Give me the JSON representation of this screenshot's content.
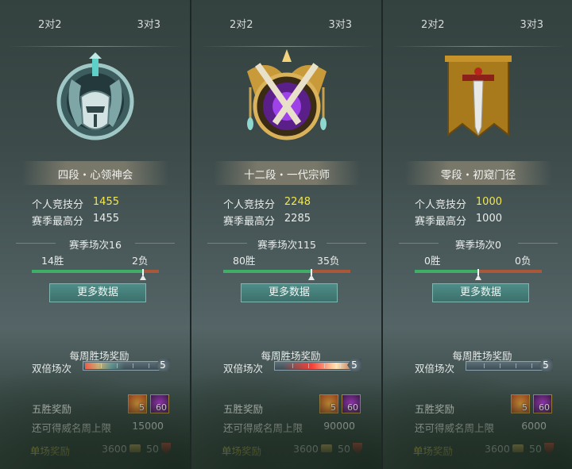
{
  "panels": [
    {
      "tabs": {
        "left": "2对2",
        "right": "3对3"
      },
      "rank": "四段・心领神会",
      "score_label": "个人竞技分",
      "score_value": "1455",
      "best_label": "赛季最高分",
      "best_value": "1455",
      "season_label": "赛季场次16",
      "wins": "14胜",
      "losses": "2负",
      "win_ratio": 0.875,
      "more_button": "更多数据",
      "weekly_title": "每周胜场奖励",
      "double_label": "双倍场次",
      "double_count": "5",
      "five_win_label": "五胜奖励",
      "item1_count": "5",
      "item2_count": "60",
      "cap_label": "还可得威名周上限",
      "cap_value": "15000",
      "single_label": "单场奖励",
      "coins": "3600",
      "shields": "50",
      "emblem": "silver-knight-emblem"
    },
    {
      "tabs": {
        "left": "2对2",
        "right": "3对3"
      },
      "rank": "十二段・一代宗师",
      "score_label": "个人竞技分",
      "score_value": "2248",
      "best_label": "赛季最高分",
      "best_value": "2285",
      "season_label": "赛季场次115",
      "wins": "80胜",
      "losses": "35负",
      "win_ratio": 0.696,
      "more_button": "更多数据",
      "weekly_title": "每周胜场奖励",
      "double_label": "双倍场次",
      "double_count": "5",
      "five_win_label": "五胜奖励",
      "item1_count": "5",
      "item2_count": "60",
      "cap_label": "还可得威名周上限",
      "cap_value": "90000",
      "single_label": "单场奖励",
      "coins": "3600",
      "shields": "50",
      "emblem": "golden-master-emblem"
    },
    {
      "tabs": {
        "left": "2对2",
        "right": "3对3"
      },
      "rank": "零段・初窥门径",
      "score_label": "个人竞技分",
      "score_value": "1000",
      "best_label": "赛季最高分",
      "best_value": "1000",
      "season_label": "赛季场次0",
      "wins": "0胜",
      "losses": "0负",
      "win_ratio": 0.5,
      "more_button": "更多数据",
      "weekly_title": "每周胜场奖励",
      "double_label": "双倍场次",
      "double_count": "5",
      "five_win_label": "五胜奖励",
      "item1_count": "5",
      "item2_count": "60",
      "cap_label": "还可得威名周上限",
      "cap_value": "6000",
      "single_label": "单场奖励",
      "coins": "3600",
      "shields": "50",
      "emblem": "banner-sword-emblem"
    }
  ],
  "colors": {
    "highlight": "#f3e74a",
    "win_bar": "#3fae66",
    "loss_bar": "#a9583a",
    "button": "#4f8d88"
  }
}
